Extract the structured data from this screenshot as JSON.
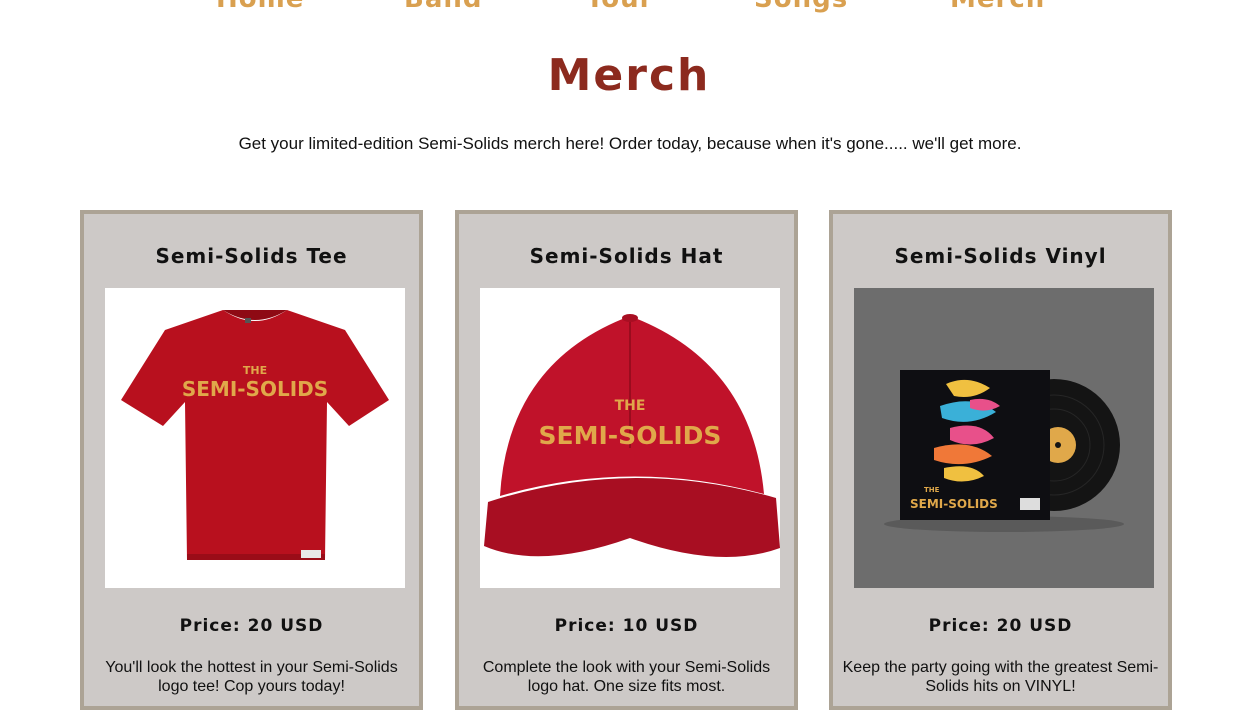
{
  "nav": {
    "items": [
      {
        "label": "Home"
      },
      {
        "label": "Band"
      },
      {
        "label": "Tour"
      },
      {
        "label": "Songs"
      },
      {
        "label": "Merch"
      }
    ]
  },
  "page": {
    "title": "Merch",
    "intro": "Get your limited-edition Semi-Solids merch here! Order today, because when it's gone..... we'll get more."
  },
  "colors": {
    "nav": "#d9a050",
    "title": "#8c2a1e",
    "card_bg": "#cdc9c7",
    "card_border": "#aca395",
    "product_red": "#b8101e",
    "logo_gold": "#e0a84a"
  },
  "products": [
    {
      "name": "Semi-Solids Tee",
      "image_icon": "red-tshirt-image",
      "logo_small": "THE",
      "logo_main": "SEMI-SOLIDS",
      "price": "Price: 20 USD",
      "description": "You'll look the hottest in your Semi-Solids logo tee! Cop yours today!"
    },
    {
      "name": "Semi-Solids Hat",
      "image_icon": "red-cap-image",
      "logo_small": "THE",
      "logo_main": "SEMI-SOLIDS",
      "price": "Price: 10 USD",
      "description": "Complete the look with your Semi-Solids logo hat. One size fits most."
    },
    {
      "name": "Semi-Solids Vinyl",
      "image_icon": "vinyl-record-image",
      "logo_small": "THE",
      "logo_main": "SEMI-SOLIDS",
      "price": "Price: 20 USD",
      "description": "Keep the party going with the greatest Semi-Solids hits on VINYL!"
    }
  ]
}
